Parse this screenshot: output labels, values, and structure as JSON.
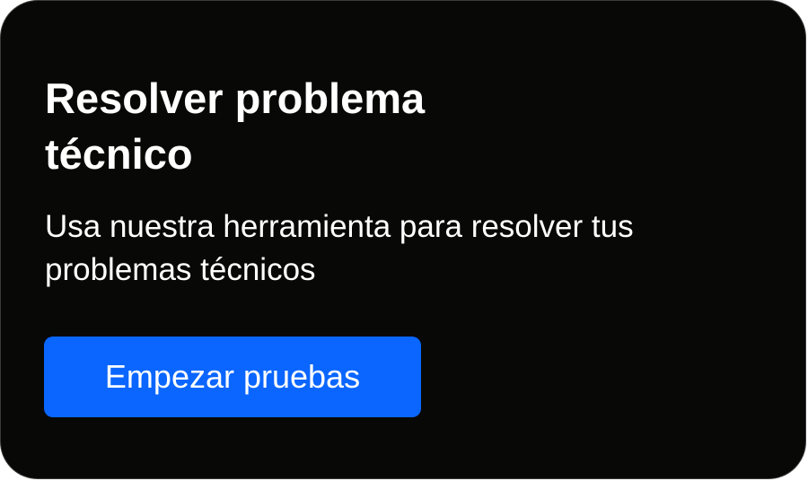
{
  "card": {
    "title": "Resolver problema técnico",
    "description": "Usa nuestra herramienta para resolver tus problemas técnicos",
    "button_label": "Empezar pruebas"
  },
  "colors": {
    "card_background": "#080806",
    "button_background": "#0a66ff",
    "text": "#ffffff"
  }
}
